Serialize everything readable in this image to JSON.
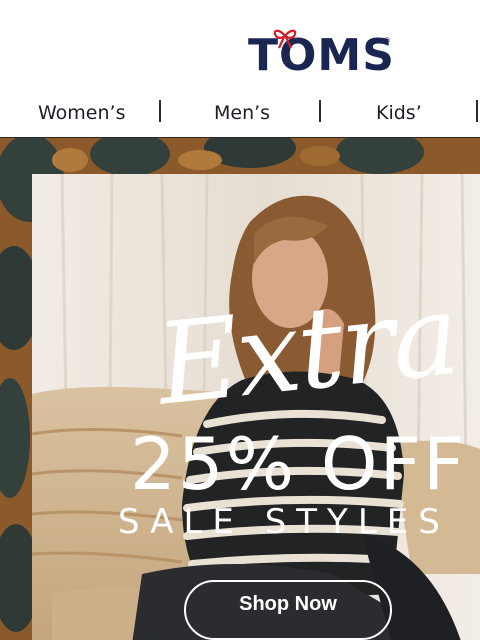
{
  "brand": {
    "logo_text": "TOMS",
    "registered_mark": "®"
  },
  "nav": {
    "items": [
      {
        "label": "Women’s"
      },
      {
        "label": "Men’s"
      },
      {
        "label": "Kids’"
      }
    ]
  },
  "hero": {
    "promo_script": "Extra",
    "promo_discount": "25% OFF",
    "promo_subtitle": "SALE STYLES",
    "cta_label": "Shop Now"
  },
  "colors": {
    "brand_navy": "#1b2552",
    "bow_red": "#d21e2b",
    "leopard_brown": "#8c5a2a",
    "leopard_dark": "#33403c",
    "promo_text": "#ffffff"
  },
  "icons": {
    "logo_bow": "bow-icon"
  }
}
